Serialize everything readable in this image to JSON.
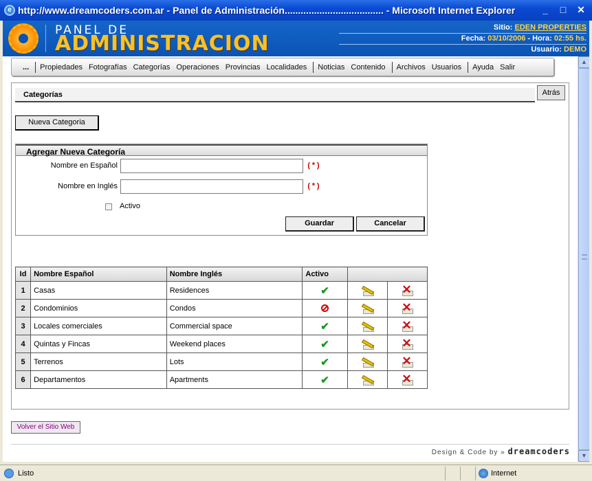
{
  "window": {
    "title": "http://www.dreamcoders.com.ar - Panel de Administración..................................... - Microsoft Internet Explorer",
    "controls": [
      "_",
      "□",
      "✕"
    ]
  },
  "header": {
    "title_top": "PANEL DE",
    "title_main": "ADMINISTRACION",
    "site_label": "Sitio:",
    "site_value": "EDEN PROPERTIES",
    "date_label": "Fecha:",
    "date_value": "03/10/2006",
    "time_label": "- Hora:",
    "time_value": "02:55 hs.",
    "user_label": "Usuario:",
    "user_value": "DEMO"
  },
  "menu": {
    "grip": "...",
    "items": [
      "Propiedades",
      "Fotografías",
      "Categorías",
      "Operaciones",
      "Provincias",
      "Localidades",
      "Noticias",
      "Contenido",
      "Archivos",
      "Usuarios",
      "Ayuda",
      "Salir"
    ]
  },
  "page": {
    "title": "Categorías",
    "back_button": "Atrás",
    "new_button": "Nueva Categoria"
  },
  "form": {
    "title": "Agregar Nueva Categoría",
    "name_es_label": "Nombre en Español",
    "name_es_value": "",
    "name_en_label": "Nombre en Inglés",
    "name_en_value": "",
    "required_mark": "(*)",
    "active_label": "Activo",
    "active_checked": false,
    "save_button": "Guardar",
    "cancel_button": "Cancelar"
  },
  "table": {
    "headers": [
      "Id",
      "Nombre Español",
      "Nombre Inglés",
      "Activo",
      ""
    ],
    "rows": [
      {
        "id": "1",
        "es": "Casas",
        "en": "Residences",
        "active": true
      },
      {
        "id": "2",
        "es": "Condominios",
        "en": "Condos",
        "active": false
      },
      {
        "id": "3",
        "es": "Locales comerciales",
        "en": "Commercial space",
        "active": true
      },
      {
        "id": "4",
        "es": "Quintas y Fincas",
        "en": "Weekend places",
        "active": true
      },
      {
        "id": "5",
        "es": "Terrenos",
        "en": "Lots",
        "active": true
      },
      {
        "id": "6",
        "es": "Departamentos",
        "en": "Apartments",
        "active": true
      }
    ]
  },
  "footer": {
    "back_site_button": "Volver el Sitio Web",
    "credit_text": "Design & Code by »",
    "credit_brand": "dreamcoders"
  },
  "status": {
    "text": "Listo",
    "zone": "Internet"
  },
  "icons": {
    "active_yes": "check-icon",
    "active_no": "forbidden-icon",
    "edit": "edit-pencil-icon",
    "delete": "delete-x-icon"
  },
  "colors": {
    "header_blue": "#1565c9",
    "accent_yellow": "#f7c12a",
    "required_red": "#cc0000",
    "check_green": "#199a1b"
  }
}
